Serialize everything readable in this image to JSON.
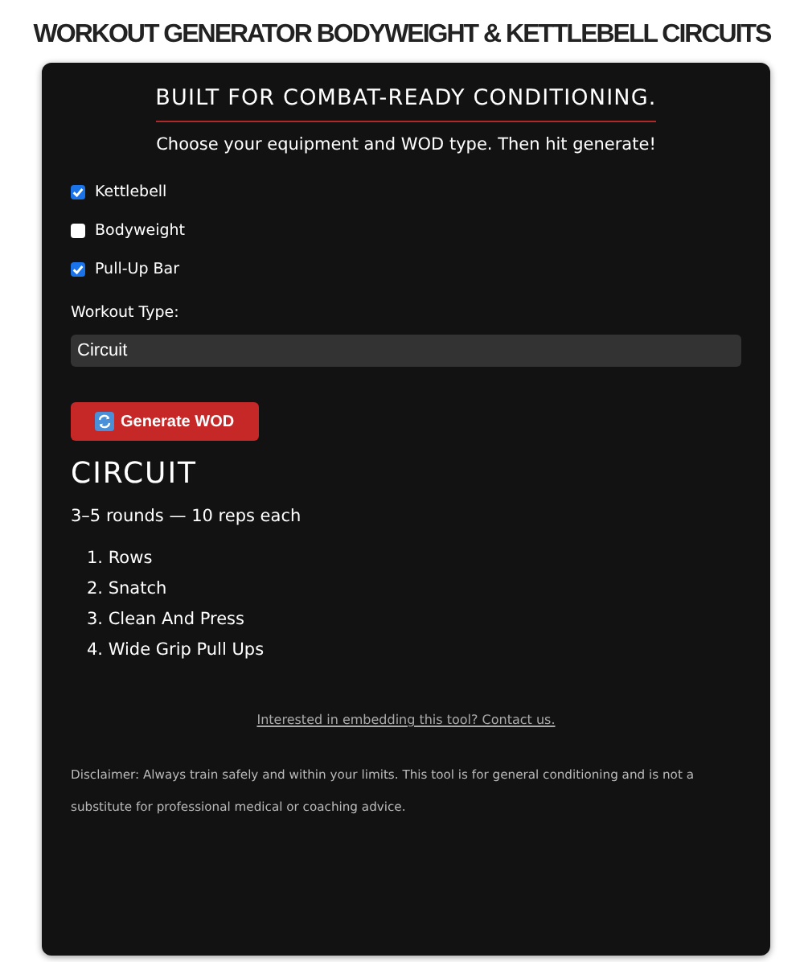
{
  "page_title": "WORKOUT GENERATOR BODYWEIGHT & KETTLEBELL CIRCUITS",
  "card": {
    "heading": "BUILT FOR COMBAT-READY CONDITIONING.",
    "subheading": "Choose your equipment and WOD type. Then hit generate!",
    "equipment": [
      {
        "label": "Kettlebell",
        "checked": true
      },
      {
        "label": "Bodyweight",
        "checked": false
      },
      {
        "label": "Pull-Up Bar",
        "checked": true
      }
    ],
    "workout_type": {
      "label": "Workout Type:",
      "value": "Circuit"
    },
    "generate_button": "Generate WOD",
    "result": {
      "title": "CIRCUIT",
      "scheme": "3–5 rounds — 10 reps each",
      "exercises": [
        {
          "number": "1.",
          "name": "Rows"
        },
        {
          "number": "2.",
          "name": "Snatch"
        },
        {
          "number": "3.",
          "name": "Clean And Press"
        },
        {
          "number": "4.",
          "name": "Wide Grip Pull Ups"
        }
      ]
    },
    "contact_link": "Interested in embedding this tool? Contact us.",
    "disclaimer": "Disclaimer: Always train safely and within your limits. This tool is for general conditioning and is not a substitute for professional medical or coaching advice."
  }
}
